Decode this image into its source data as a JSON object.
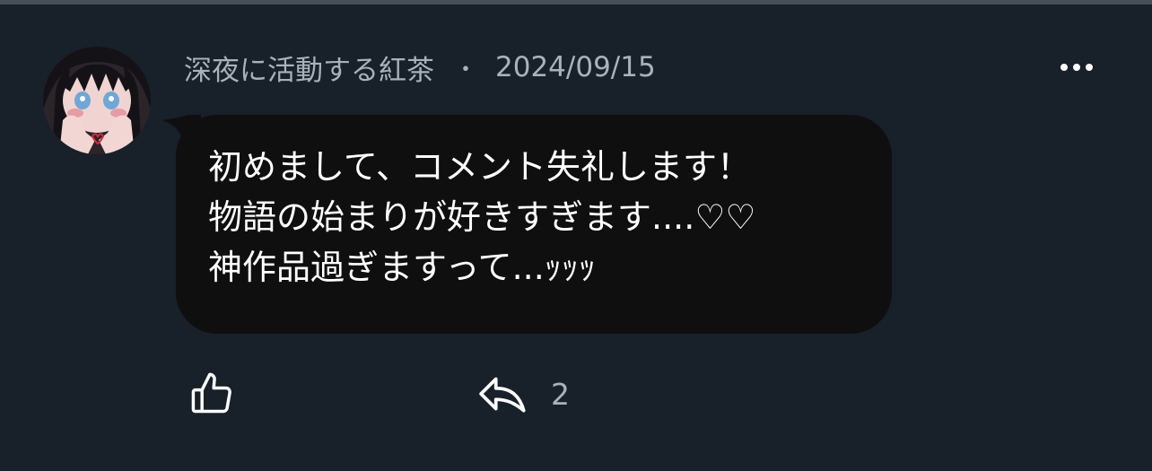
{
  "comment": {
    "author": "深夜に活動する紅茶",
    "separator": "・",
    "date": "2024/09/15",
    "body_lines": [
      "初めまして、コメント失礼します！",
      "物語の始まりが好きすぎます....♡♡",
      "神作品過ぎますって...ｯｯｯ"
    ],
    "reply_count": "2"
  },
  "icons": {
    "like": "thumbs-up-icon",
    "reply": "reply-all-icon",
    "more": "more-horizontal-icon"
  },
  "colors": {
    "background": "#18202a",
    "bubble": "#0f0f10",
    "meta_text": "#a9b2bc",
    "body_text": "#ffffff"
  }
}
